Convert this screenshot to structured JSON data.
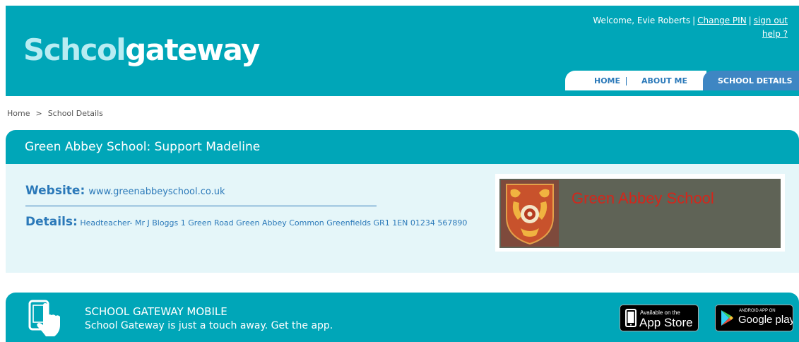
{
  "header": {
    "logo_part1": "Schcol",
    "logo_part2": "gateway",
    "welcome_text": "Welcome, Evie Roberts",
    "change_pin_label": "Change PIN",
    "sign_out_label": "sign out",
    "help_label": "help ?",
    "brand_color": "#00a6b8"
  },
  "nav": {
    "tabs": [
      {
        "label": "HOME"
      },
      {
        "label": "ABOUT ME"
      },
      {
        "label": "SCHOOL DETAILS",
        "active": true
      }
    ]
  },
  "breadcrumb": {
    "items": [
      "Home",
      "School Details"
    ],
    "separator": ">"
  },
  "panel": {
    "title": "Green Abbey School: Support Madeline",
    "website_label": "Website:",
    "website_url": "www.greenabbeyschool.co.uk",
    "details_label": "Details:",
    "details_text": "Headteacher- Mr J Bloggs 1 Green Road Green Abbey Common Greenfields GR1 1EN 01234 567890",
    "banner_text": "Green Abbey School",
    "banner_text_color": "#d4261b",
    "banner_bg_color": "#5f6356"
  },
  "mobile": {
    "title": "SCHOOL GATEWAY MOBILE",
    "subtitle": "School Gateway is just a touch away. Get the app.",
    "icon": "phone-touch-icon",
    "appstore_small": "Available on the",
    "appstore_big": "App Store",
    "googleplay_small": "ANDROID APP ON",
    "googleplay_big": "Google play"
  }
}
